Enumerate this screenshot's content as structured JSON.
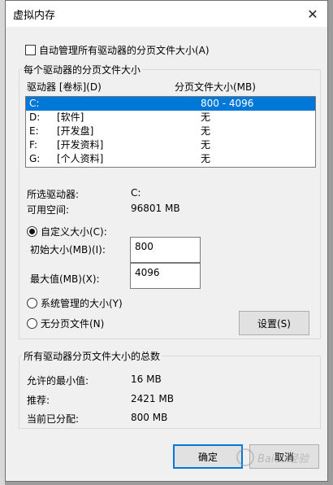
{
  "window": {
    "title": "虚拟内存",
    "close_glyph": "✕"
  },
  "auto_manage": {
    "label": "自动管理所有驱动器的分页文件大小(A)",
    "checked": false
  },
  "per_drive": {
    "group_label": "每个驱动器的分页文件大小",
    "col_drive": "驱动器 [卷标](D)",
    "col_size": "分页文件大小(MB)",
    "rows": [
      {
        "drive": "C:",
        "volume": "",
        "size": "800 - 4096",
        "selected": true
      },
      {
        "drive": "D:",
        "volume": "[软件]",
        "size": "无",
        "selected": false
      },
      {
        "drive": "E:",
        "volume": "[开发盘]",
        "size": "无",
        "selected": false
      },
      {
        "drive": "F:",
        "volume": "[开发资料]",
        "size": "无",
        "selected": false
      },
      {
        "drive": "G:",
        "volume": "[个人资料]",
        "size": "无",
        "selected": false
      }
    ],
    "selected_drive_label": "所选驱动器:",
    "selected_drive_value": "C:",
    "free_space_label": "可用空间:",
    "free_space_value": "96801 MB",
    "custom_size_label": "自定义大小(C):",
    "initial_size_label": "初始大小(MB)(I):",
    "initial_size_value": "800",
    "max_size_label": "最大值(MB)(X):",
    "max_size_value": "4096",
    "system_managed_label": "系统管理的大小(Y)",
    "no_paging_label": "无分页文件(N)",
    "set_button": "设置(S)",
    "selected_option": "custom"
  },
  "totals": {
    "group_label": "所有驱动器分页文件大小的总数",
    "min_label": "允许的最小值:",
    "min_value": "16 MB",
    "recommended_label": "推荐:",
    "recommended_value": "2421 MB",
    "current_label": "当前已分配:",
    "current_value": "800 MB"
  },
  "buttons": {
    "ok": "确定",
    "cancel": "取消"
  },
  "watermark": {
    "text": "Baidu经验"
  },
  "colors": {
    "selection": "#0078d7",
    "dialog_bg": "#f0f0f0"
  }
}
